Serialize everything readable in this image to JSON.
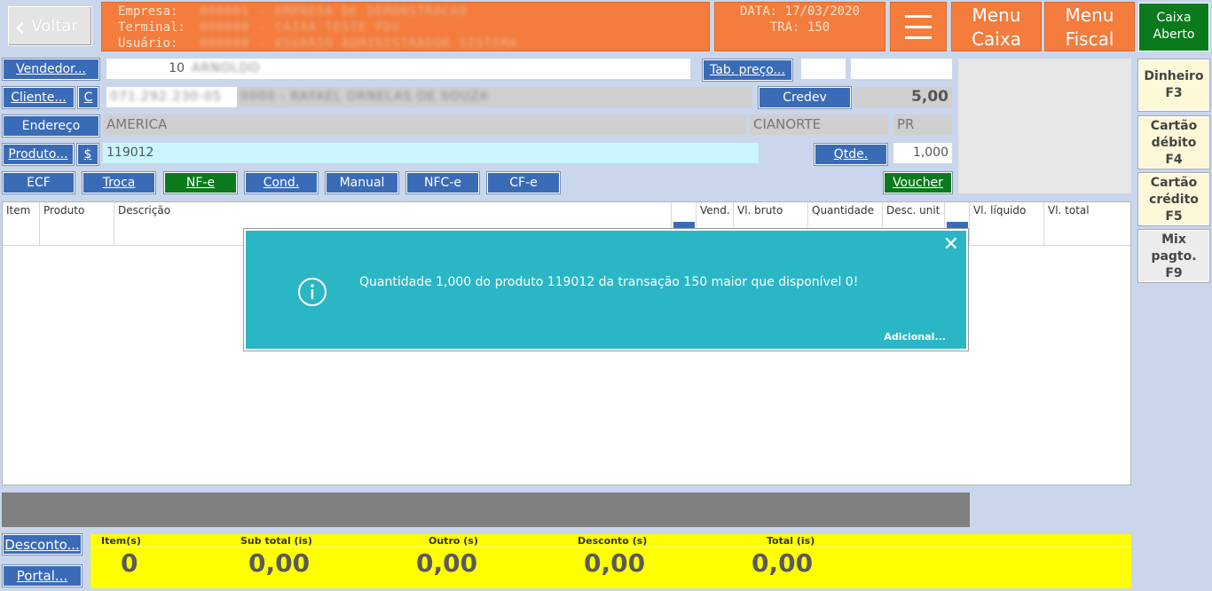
{
  "header": {
    "back_label": "Voltar",
    "empresa_label": "Empresa:",
    "empresa_value": "000001 - EMPRESA DE DEMONSTRACAO",
    "terminal_label": "Terminal:",
    "terminal_value": "000000 - CAIXA TESTE PDV",
    "usuario_label": "Usuário:",
    "usuario_value": "000000 - USUARIO ADMINISTRADOR SISTEMA",
    "data_label": "DATA:",
    "data_value": "17/03/2020",
    "tra_label": "TRA:",
    "tra_value": "150",
    "menu_caixa_line1": "Menu",
    "menu_caixa_line2": "Caixa",
    "menu_fiscal_line1": "Menu",
    "menu_fiscal_line2": "Fiscal",
    "caixa_line1": "Caixa",
    "caixa_line2": "Aberto"
  },
  "form": {
    "vendedor_button": "Vendedor...",
    "vendedor_code": "10",
    "vendedor_name": "ARNOLDO",
    "tab_preco_button": "Tab. preço...",
    "cliente_button": "Cliente...",
    "cliente_c_button": "C",
    "cliente_doc": "071.292.230-05",
    "cliente_name": "0000 - RAFAEL ORNELAS DE SOUZA",
    "credev_button": "Credev",
    "credev_value": "5,00",
    "endereco_button": "Endereço",
    "endereco_value": "AMERICA",
    "cidade_value": "CIANORTE",
    "uf_value": "PR",
    "produto_button": "Produto...",
    "produto_dollar_button": "$",
    "produto_value": "119012",
    "qtde_button": "Qtde.",
    "qtde_value": "1,000"
  },
  "action_buttons": {
    "ecf": "ECF",
    "troca": "Troca",
    "nfe": "NF-e",
    "cond": "Cond.",
    "manual": "Manual",
    "nfce": "NFC-e",
    "cfe": "CF-e",
    "voucher": "Voucher"
  },
  "payment_buttons": {
    "dinheiro_line1": "Dinheiro",
    "dinheiro_line2": "F3",
    "debito_line1": "Cartão",
    "debito_line2": "débito",
    "debito_line3": "F4",
    "credito_line1": "Cartão",
    "credito_line2": "crédito",
    "credito_line3": "F5",
    "mix_line1": "Mix",
    "mix_line2": "pagto.",
    "mix_line3": "F9"
  },
  "table": {
    "columns": [
      "Item",
      "Produto",
      "Descrição",
      "Vend.",
      "Vl. bruto",
      "Quantidade",
      "Desc. unit",
      "Vl. líquido",
      "Vl. total"
    ]
  },
  "dialog": {
    "message": "Quantidade 1,000 do produto 119012 da transação 150 maior que disponível 0!",
    "more_label": "Adicional...",
    "close_glyph": "✕"
  },
  "footer": {
    "desconto_button": "Desconto...",
    "portal_button": "Portal...",
    "items_label": "Item(s)",
    "items_value": "0",
    "subtotal_label": "Sub total (is)",
    "subtotal_value": "0,00",
    "outro_label": "Outro (s)",
    "outro_value": "0,00",
    "desconto_label": "Desconto (s)",
    "desconto_value": "0,00",
    "total_label": "Total (is)",
    "total_value": "0,00"
  },
  "colors": {
    "orange": "#f47c3c",
    "green": "#0b7a1c",
    "blue": "#3a6bb7",
    "teal": "#2bb6c6",
    "yellow": "#ffff00"
  }
}
